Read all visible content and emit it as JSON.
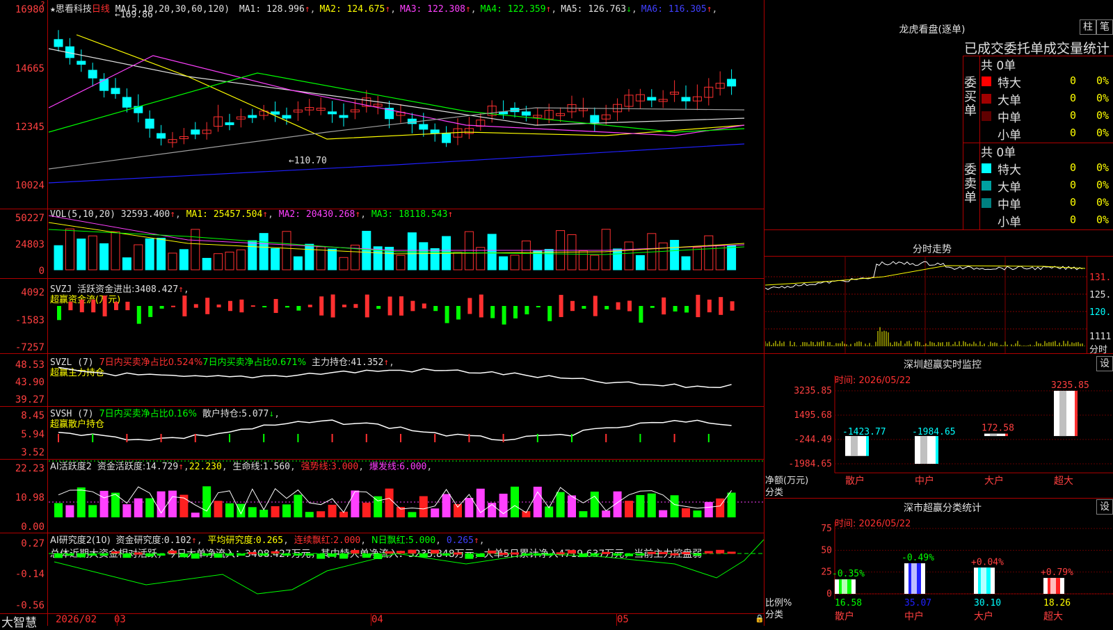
{
  "stock": {
    "star": "★",
    "name": "思看科技",
    "period": "日线",
    "mark": "?"
  },
  "ma_header": {
    "label": "MA(5,10,20,30,60,120)",
    "items": [
      {
        "name": "MA1",
        "value": "128.996",
        "arrow": "↑",
        "color": "#e0e0e0"
      },
      {
        "name": "MA2",
        "value": "124.675",
        "arrow": "↑",
        "color": "#ffff00"
      },
      {
        "name": "MA3",
        "value": "122.308",
        "arrow": "↑",
        "color": "#ff40ff"
      },
      {
        "name": "MA4",
        "value": "122.359",
        "arrow": "↑",
        "color": "#00ff00"
      },
      {
        "name": "MA5",
        "value": "126.763",
        "arrow": "↓",
        "color": "#e0e0e0"
      },
      {
        "name": "MA6",
        "value": "116.305",
        "arrow": "↑",
        "color": "#4040ff"
      }
    ]
  },
  "price_panel": {
    "yticks": [
      "16980",
      "14665",
      "12345",
      "10024"
    ],
    "high_label": "169.86",
    "low_label": "110.70"
  },
  "vol_header": {
    "label": "VOL(5,10,20)",
    "value": "32593.400",
    "ma1": "25457.504",
    "ma2": "20430.268",
    "ma3": "18118.543",
    "arrow": "↑"
  },
  "vol_panel": {
    "yticks": [
      "50227",
      "24803",
      "0"
    ]
  },
  "svzj": {
    "label": "SVZJ",
    "title": "活跃资金进出:",
    "value": "3408.427",
    "arrow": "↑",
    "sub": "超赢资金流(万元)",
    "yticks": [
      "4092",
      "-1583",
      "-7257"
    ]
  },
  "svzl": {
    "label": "SVZL (7)",
    "t1": "7日内买卖净占比0.524%",
    "t2": "7日内买卖净占比0.671%",
    "t3": "主力持仓:",
    "v3": "41.352",
    "arrow": "↑",
    "sub": "超赢主力持仓",
    "yticks": [
      "48.53",
      "43.90",
      "39.27"
    ]
  },
  "svsh": {
    "label": "SVSH (7)",
    "t1": "7日内买卖净占比0.16%",
    "t2": "散户持仓:",
    "v2": "5.077",
    "arrow": "↓",
    "sub": "超赢散户持仓",
    "yticks": [
      "8.45",
      "5.94",
      "3.52"
    ]
  },
  "ai_active": {
    "label": "AI活跃度2",
    "t1": "资金活跃度:",
    "v1": "14.729",
    "v2": "22.230",
    "t3": "生命线:",
    "v3": "1.560",
    "t4": "强势线:",
    "v4": "3.000",
    "t5": "爆发线:",
    "v5": "6.000",
    "yticks": [
      "22.23",
      "10.98",
      "0.00"
    ]
  },
  "ai_research": {
    "label": "AI研究度2(10)",
    "t1": "资金研究度:",
    "v1": "0.102",
    "t2": "平均研究度:",
    "v2": "0.265",
    "t3": "连续飘红:",
    "v3": "2.000",
    "t4": "N日飘红:",
    "v4": "5.000",
    "v5": "0.265",
    "summary": "总体近期大资金相对活跃，今日大单净流入：3408.427万元，其中特大单净流入：3235.848万元，大单5日累计净入4719.637万元，当前主力控盘弱",
    "yticks": [
      "0.27",
      "-0.14",
      "-0.56"
    ]
  },
  "xaxis": {
    "logo": "大智慧",
    "labels": [
      "2026/02",
      "03",
      "04",
      "05"
    ]
  },
  "right": {
    "lhb_title": "龙虎看盘(逐单)",
    "btn1": "柱",
    "btn2": "笔",
    "table_title": "已成交委托单成交量统计",
    "buy": {
      "side": "委买单",
      "total": "共 0单",
      "rows": [
        {
          "name": "特大",
          "count": "0",
          "pct": "0%",
          "color": "#ff0000"
        },
        {
          "name": "大单",
          "count": "0",
          "pct": "0%",
          "color": "#a00000"
        },
        {
          "name": "中单",
          "count": "0",
          "pct": "0%",
          "color": "#600000"
        },
        {
          "name": "小单",
          "count": "0",
          "pct": "0%",
          "color": ""
        }
      ]
    },
    "sell": {
      "side": "委卖单",
      "total": "共 0单",
      "rows": [
        {
          "name": "特大",
          "count": "0",
          "pct": "0%",
          "color": "#00ffff"
        },
        {
          "name": "大单",
          "count": "0",
          "pct": "0%",
          "color": "#00a0a0"
        },
        {
          "name": "中单",
          "count": "0",
          "pct": "0%",
          "color": "#008080"
        },
        {
          "name": "小单",
          "count": "0",
          "pct": "0%",
          "color": ""
        }
      ]
    },
    "intraday": {
      "title": "分时走势",
      "p1": "131.",
      "p2": "125.",
      "p3": "120.",
      "v1": "1111",
      "v2": "分时"
    },
    "monitor": {
      "title": "深圳超赢实时监控",
      "btn": "设",
      "time": "时间: 2026/05/22",
      "yticks": [
        "3235.85",
        "1495.68",
        "-244.49",
        "-1984.65"
      ],
      "ylabel": "净额(万元)",
      "xlabel": "分类",
      "bars": [
        {
          "name": "散户",
          "value": -1423.77,
          "label": "-1423.77"
        },
        {
          "name": "中户",
          "value": -1984.65,
          "label": "-1984.65"
        },
        {
          "name": "大户",
          "value": 172.58,
          "label": "172.58"
        },
        {
          "name": "超大",
          "value": 3235.85,
          "label": "3235.85"
        }
      ]
    },
    "classify": {
      "title": "深市超赢分类统计",
      "btn": "设",
      "time": "时间: 2026/05/22",
      "yticks": [
        "75",
        "50",
        "25",
        "0"
      ],
      "ylabel": "比例%",
      "xlabel": "分类",
      "bars": [
        {
          "name": "散户",
          "value": 16.58,
          "change": "-0.35%",
          "label": "16.58",
          "color": "#00ff00"
        },
        {
          "name": "中户",
          "value": 35.07,
          "change": "-0.49%",
          "label": "35.07",
          "color": "#2020ff"
        },
        {
          "name": "大户",
          "value": 30.1,
          "change": "+0.04%",
          "label": "30.10",
          "color": "#00ffff"
        },
        {
          "name": "超大",
          "value": 18.26,
          "change": "+0.79%",
          "label": "18.26",
          "color": "#ff2020"
        }
      ]
    }
  }
}
